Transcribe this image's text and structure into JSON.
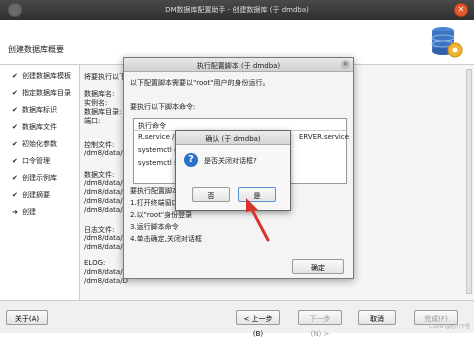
{
  "window": {
    "title": "DM数据库配置助手 - 创建数据库 (于 dmdba)"
  },
  "header": {
    "title": "创建数据库概要",
    "icon": "database-gear-icon"
  },
  "steps": [
    {
      "label": "创建数据库模板",
      "mark": "✔"
    },
    {
      "label": "指定数据库目录",
      "mark": "✔"
    },
    {
      "label": "数据库标识",
      "mark": "✔"
    },
    {
      "label": "数据库文件",
      "mark": "✔"
    },
    {
      "label": "初始化参数",
      "mark": "✔"
    },
    {
      "label": "口令管理",
      "mark": "✔"
    },
    {
      "label": "创建示例库",
      "mark": "✔"
    },
    {
      "label": "创建摘要",
      "mark": "✔"
    },
    {
      "label": "创建",
      "mark": "➜"
    }
  ],
  "content": {
    "intro": "将要执行以下",
    "fields": [
      "数据库名:",
      "实例名:",
      "数据库目录:",
      "端口:"
    ],
    "control_file_label": "控制文件:",
    "control_file_path": "/dm8/data/D",
    "data_file_label": "数据文件:",
    "data_file_paths": [
      "/dm8/data/D",
      "/dm8/data/D",
      "/dm8/data/D",
      "/dm8/data/D"
    ],
    "log_file_label": "日志文件:",
    "log_file_paths": [
      "/dm8/data/D",
      "/dm8/data/D"
    ],
    "elog_label": "ELOG:",
    "elog_paths": [
      "/dm8/data/D",
      "/dm8/data/D"
    ]
  },
  "script_dialog": {
    "title": "执行配置脚本 (于 dmdba)",
    "desc": "以下配置脚本需要以\"root\"用户的身份运行。",
    "cmd_label": "要执行以下脚本命令:",
    "cmd_header": "执行命令",
    "commands": [
      "R.service /us",
      "systemctl en",
      "systemctl st"
    ],
    "commands_right": "ERVER.service",
    "steps_label": "要执行配置脚本",
    "steps": [
      "1.打开终端窗口",
      "2.以\"root\"身份登录",
      "3.运行脚本命令",
      "4.单击确定,关闭对话框"
    ],
    "ok_label": "确定"
  },
  "confirm_dialog": {
    "title": "确认 (于 dmdba)",
    "message": "是否关闭对话框?",
    "no_label": "否",
    "yes_label": "是"
  },
  "buttons": {
    "help": "关于(A)",
    "back": "< 上一步(B)",
    "next": "下一步(N) >",
    "cancel": "取消",
    "finish": "完成(F)"
  },
  "watermark": "CSDN @若川下雪",
  "colors": {
    "accent": "#2a72c8",
    "arrow": "#d9342b"
  }
}
